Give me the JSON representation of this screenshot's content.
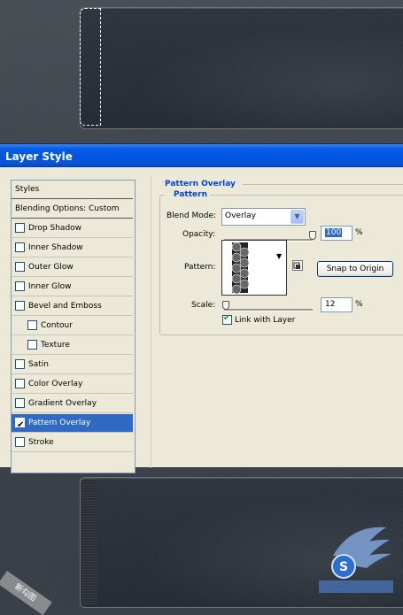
{
  "dialog": {
    "title": "Layer Style"
  },
  "styles_list": {
    "header": "Styles",
    "blending": "Blending Options: Custom",
    "items": [
      {
        "label": "Drop Shadow",
        "checked": false,
        "indent": false,
        "selected": false
      },
      {
        "label": "Inner Shadow",
        "checked": false,
        "indent": false,
        "selected": false
      },
      {
        "label": "Outer Glow",
        "checked": false,
        "indent": false,
        "selected": false
      },
      {
        "label": "Inner Glow",
        "checked": false,
        "indent": false,
        "selected": false
      },
      {
        "label": "Bevel and Emboss",
        "checked": false,
        "indent": false,
        "selected": false
      },
      {
        "label": "Contour",
        "checked": false,
        "indent": true,
        "selected": false
      },
      {
        "label": "Texture",
        "checked": false,
        "indent": true,
        "selected": false
      },
      {
        "label": "Satin",
        "checked": false,
        "indent": false,
        "selected": false
      },
      {
        "label": "Color Overlay",
        "checked": false,
        "indent": false,
        "selected": false
      },
      {
        "label": "Gradient Overlay",
        "checked": false,
        "indent": false,
        "selected": false
      },
      {
        "label": "Pattern Overlay",
        "checked": true,
        "indent": false,
        "selected": true
      },
      {
        "label": "Stroke",
        "checked": false,
        "indent": false,
        "selected": false
      }
    ]
  },
  "pattern_overlay": {
    "group_title": "Pattern Overlay",
    "sub_title": "Pattern",
    "blend_mode_label": "Blend Mode:",
    "blend_mode_value": "Overlay",
    "opacity_label": "Opacity:",
    "opacity_value": "100",
    "opacity_unit": "%",
    "opacity_level": 1.0,
    "pattern_label": "Pattern:",
    "snap_button": "Snap to Origin",
    "scale_label": "Scale:",
    "scale_value": "12",
    "scale_unit": "%",
    "scale_level": 0.02,
    "link_label": "Link with Layer",
    "link_checked": true
  },
  "watermark": {
    "left_text": "新勾图"
  },
  "colors": {
    "title_bar": "#0054e3",
    "dialog_bg": "#ece9d8",
    "selection": "#316ac5",
    "group_title": "#0046d5"
  }
}
